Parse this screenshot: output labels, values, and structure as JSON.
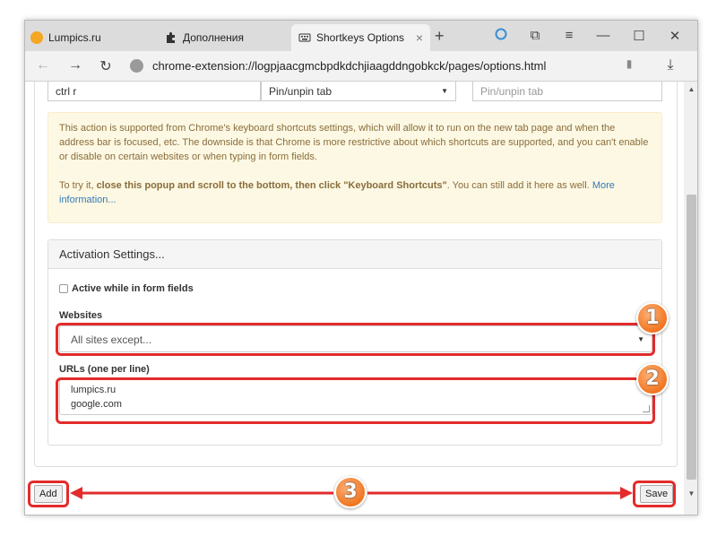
{
  "tabs": [
    {
      "label": "Lumpics.ru",
      "icon": "orange-circle-icon"
    },
    {
      "label": "Дополнения",
      "icon": "puzzle-icon"
    },
    {
      "label": "Shortkeys Options",
      "icon": "keyboard-icon",
      "active": true
    }
  ],
  "address_bar": {
    "url": "chrome-extension://logpjaacgmcbpdkdchjiaagddngobkck/pages/options.html"
  },
  "shortcut_row": {
    "key": "ctrl r",
    "action": "Pin/unpin tab",
    "label_placeholder": "Pin/unpin tab"
  },
  "alert": {
    "text1": "This action is supported from Chrome's keyboard shortcuts settings, which will allow it to run on the new tab page and when the address bar is focused, etc. The downside is that Chrome is more restrictive about which shortcuts are supported, and you can't enable or disable on certain websites or when typing in form fields.",
    "text2_prefix": "To try it, ",
    "text2_bold": "close this popup and scroll to the bottom, then click \"Keyboard Shortcuts\"",
    "text2_suffix": ". You can still add it here as well. ",
    "link": "More information..."
  },
  "activation": {
    "heading": "Activation Settings...",
    "checkbox_label": "Active while in form fields",
    "websites_label": "Websites",
    "websites_value": "All sites except...",
    "urls_label": "URLs (one per line)",
    "urls_lines": [
      "lumpics.ru",
      "google.com"
    ]
  },
  "footer": {
    "add_label": "Add",
    "save_label": "Save"
  },
  "annotations": {
    "badges": [
      "1",
      "2",
      "3"
    ],
    "color": "#e32b2b"
  }
}
